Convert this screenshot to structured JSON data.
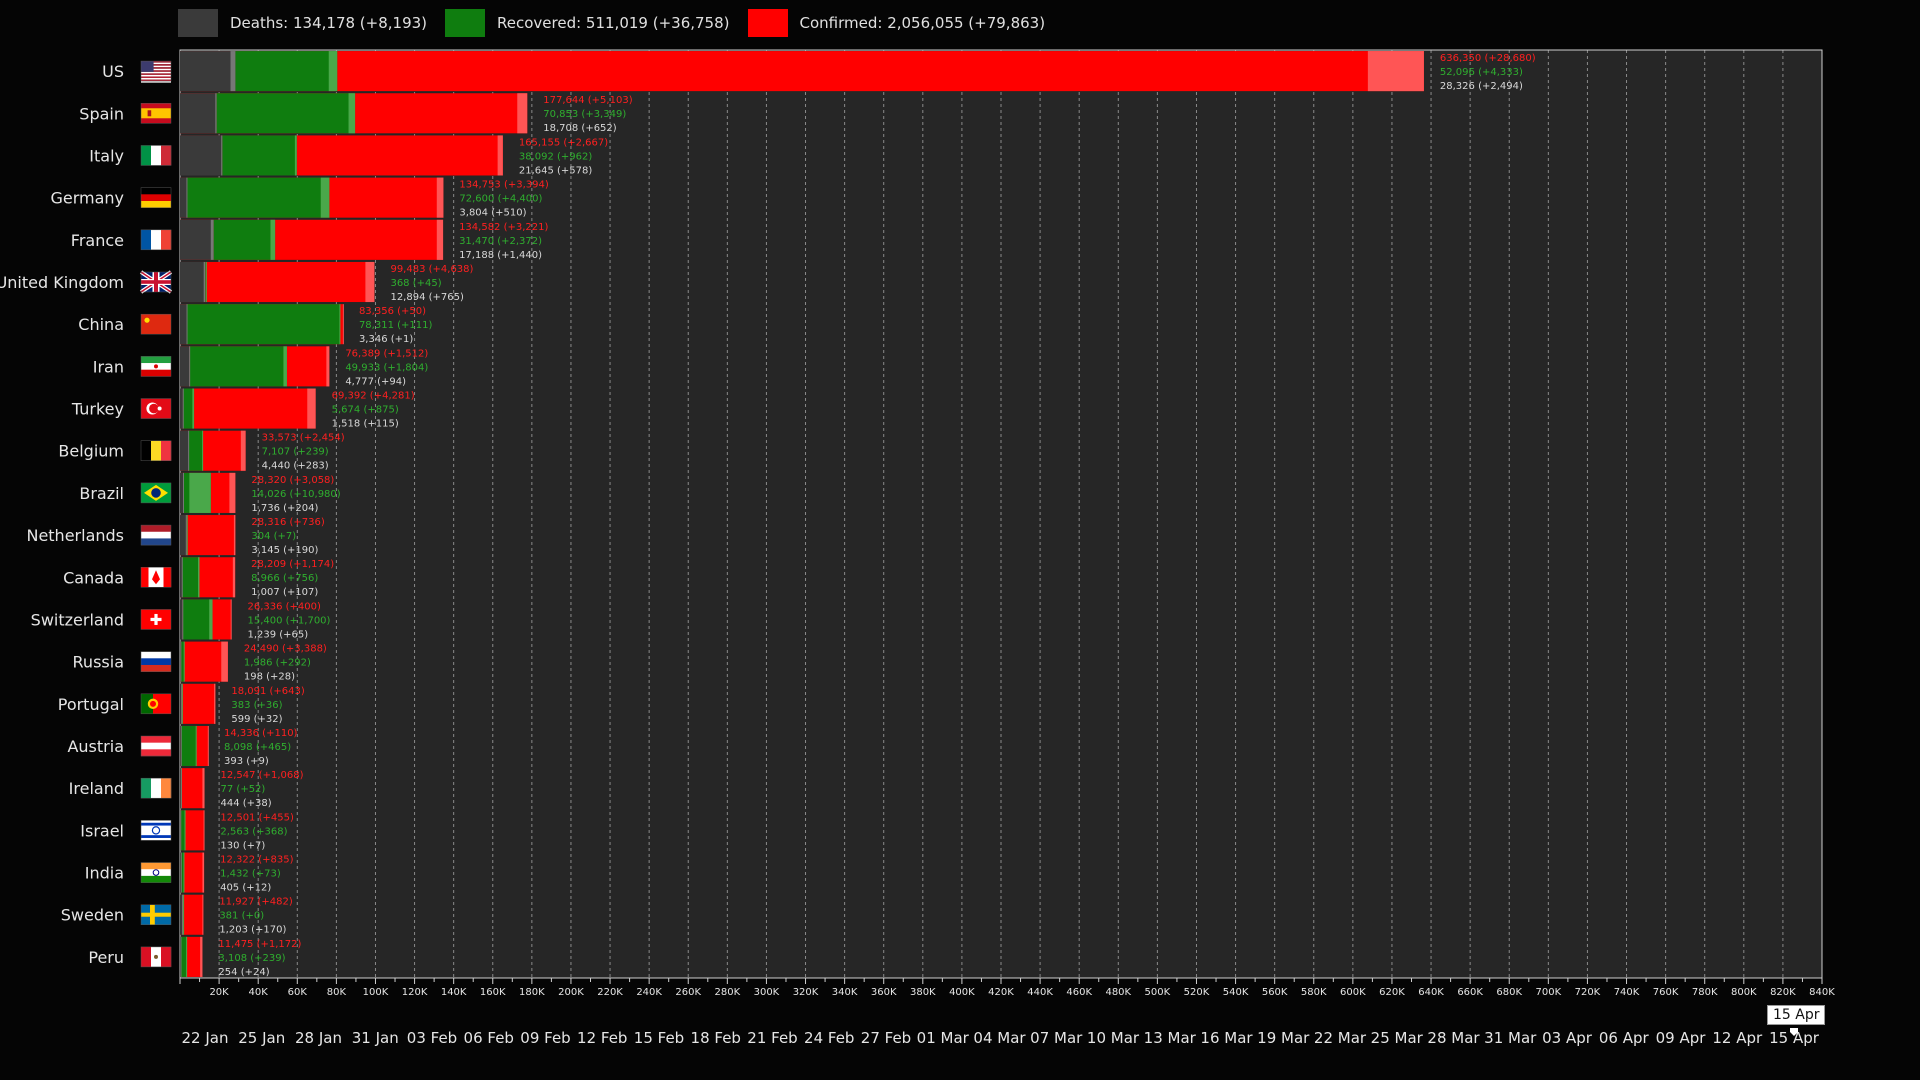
{
  "legend": {
    "deaths": "Deaths: 134,178 (+8,193)",
    "recovered": "Recovered: 511,019 (+36,758)",
    "confirmed": "Confirmed: 2,056,055 (+79,863)"
  },
  "colors": {
    "deaths": "#3a3a3a",
    "recovered": "#0f7d0f",
    "confirmed": "#ff0000",
    "background": "#050505",
    "plot_background": "#262626"
  },
  "current_date": "15 Apr",
  "chart_data": {
    "type": "bar",
    "orientation": "horizontal",
    "stacked": true,
    "xlim": [
      0,
      840000
    ],
    "x_ticks": [
      "20K",
      "40K",
      "60K",
      "80K",
      "100K",
      "120K",
      "140K",
      "160K",
      "180K",
      "200K",
      "220K",
      "240K",
      "260K",
      "280K",
      "300K",
      "320K",
      "340K",
      "360K",
      "380K",
      "400K",
      "420K",
      "440K",
      "460K",
      "480K",
      "500K",
      "520K",
      "540K",
      "560K",
      "580K",
      "600K",
      "620K",
      "640K",
      "660K",
      "680K",
      "700K",
      "720K",
      "740K",
      "760K",
      "780K",
      "800K",
      "820K",
      "840K"
    ],
    "grid": true,
    "legend_position": "top-left",
    "countries": [
      {
        "name": "US",
        "flag": "us",
        "deaths": 28326,
        "recovered": 52096,
        "confirmed": 636350,
        "deaths_label": "28,326 (+2,494)",
        "recovered_label": "52,096 (+4,333)",
        "confirmed_label": "636,350 (+28,680)",
        "new_confirmed": 28680,
        "new_recovered": 4333,
        "new_deaths": 2494
      },
      {
        "name": "Spain",
        "flag": "es",
        "deaths": 18708,
        "recovered": 70853,
        "confirmed": 177644,
        "deaths_label": "18,708 (+652)",
        "recovered_label": "70,853 (+3,349)",
        "confirmed_label": "177,644 (+5,103)",
        "new_confirmed": 5103,
        "new_recovered": 3349,
        "new_deaths": 652
      },
      {
        "name": "Italy",
        "flag": "it",
        "deaths": 21645,
        "recovered": 38092,
        "confirmed": 165155,
        "deaths_label": "21,645 (+578)",
        "recovered_label": "38,092 (+962)",
        "confirmed_label": "165,155 (+2,667)",
        "new_confirmed": 2667,
        "new_recovered": 962,
        "new_deaths": 578
      },
      {
        "name": "Germany",
        "flag": "de",
        "deaths": 3804,
        "recovered": 72600,
        "confirmed": 134753,
        "deaths_label": "3,804 (+510)",
        "recovered_label": "72,600 (+4,400)",
        "confirmed_label": "134,753 (+3,394)",
        "new_confirmed": 3394,
        "new_recovered": 4400,
        "new_deaths": 510
      },
      {
        "name": "France",
        "flag": "fr",
        "deaths": 17188,
        "recovered": 31470,
        "confirmed": 134582,
        "deaths_label": "17,188 (+1,440)",
        "recovered_label": "31,470 (+2,372)",
        "confirmed_label": "134,582 (+3,221)",
        "new_confirmed": 3221,
        "new_recovered": 2372,
        "new_deaths": 1440
      },
      {
        "name": "United Kingdom",
        "flag": "gb",
        "deaths": 12894,
        "recovered": 368,
        "confirmed": 99483,
        "deaths_label": "12,894 (+765)",
        "recovered_label": "368 (+45)",
        "confirmed_label": "99,483 (+4,638)",
        "new_confirmed": 4638,
        "new_recovered": 45,
        "new_deaths": 765
      },
      {
        "name": "China",
        "flag": "cn",
        "deaths": 3346,
        "recovered": 78311,
        "confirmed": 83356,
        "deaths_label": "3,346 (+1)",
        "recovered_label": "78,311 (+111)",
        "confirmed_label": "83,356 (+50)",
        "new_confirmed": 50,
        "new_recovered": 111,
        "new_deaths": 1
      },
      {
        "name": "Iran",
        "flag": "ir",
        "deaths": 4777,
        "recovered": 49933,
        "confirmed": 76389,
        "deaths_label": "4,777 (+94)",
        "recovered_label": "49,933 (+1,804)",
        "confirmed_label": "76,389 (+1,512)",
        "new_confirmed": 1512,
        "new_recovered": 1804,
        "new_deaths": 94
      },
      {
        "name": "Turkey",
        "flag": "tr",
        "deaths": 1518,
        "recovered": 5674,
        "confirmed": 69392,
        "deaths_label": "1,518 (+115)",
        "recovered_label": "5,674 (+875)",
        "confirmed_label": "69,392 (+4,281)",
        "new_confirmed": 4281,
        "new_recovered": 875,
        "new_deaths": 115
      },
      {
        "name": "Belgium",
        "flag": "be",
        "deaths": 4440,
        "recovered": 7107,
        "confirmed": 33573,
        "deaths_label": "4,440 (+283)",
        "recovered_label": "7,107 (+239)",
        "confirmed_label": "33,573 (+2,454)",
        "new_confirmed": 2454,
        "new_recovered": 239,
        "new_deaths": 283
      },
      {
        "name": "Brazil",
        "flag": "br",
        "deaths": 1736,
        "recovered": 14026,
        "confirmed": 28320,
        "deaths_label": "1,736 (+204)",
        "recovered_label": "14,026 (+10,980)",
        "confirmed_label": "28,320 (+3,058)",
        "new_confirmed": 3058,
        "new_recovered": 10980,
        "new_deaths": 204
      },
      {
        "name": "Netherlands",
        "flag": "nl",
        "deaths": 3145,
        "recovered": 304,
        "confirmed": 28316,
        "deaths_label": "3,145 (+190)",
        "recovered_label": "304 (+7)",
        "confirmed_label": "28,316 (+736)",
        "new_confirmed": 736,
        "new_recovered": 7,
        "new_deaths": 190
      },
      {
        "name": "Canada",
        "flag": "ca",
        "deaths": 1007,
        "recovered": 8966,
        "confirmed": 28209,
        "deaths_label": "1,007 (+107)",
        "recovered_label": "8,966 (+756)",
        "confirmed_label": "28,209 (+1,174)",
        "new_confirmed": 1174,
        "new_recovered": 756,
        "new_deaths": 107
      },
      {
        "name": "Switzerland",
        "flag": "ch",
        "deaths": 1239,
        "recovered": 15400,
        "confirmed": 26336,
        "deaths_label": "1,239 (+65)",
        "recovered_label": "15,400 (+1,700)",
        "confirmed_label": "26,336 (+400)",
        "new_confirmed": 400,
        "new_recovered": 1700,
        "new_deaths": 65
      },
      {
        "name": "Russia",
        "flag": "ru",
        "deaths": 198,
        "recovered": 1986,
        "confirmed": 24490,
        "deaths_label": "198 (+28)",
        "recovered_label": "1,986 (+292)",
        "confirmed_label": "24,490 (+3,388)",
        "new_confirmed": 3388,
        "new_recovered": 292,
        "new_deaths": 28
      },
      {
        "name": "Portugal",
        "flag": "pt",
        "deaths": 599,
        "recovered": 383,
        "confirmed": 18091,
        "deaths_label": "599 (+32)",
        "recovered_label": "383 (+36)",
        "confirmed_label": "18,091 (+643)",
        "new_confirmed": 643,
        "new_recovered": 36,
        "new_deaths": 32
      },
      {
        "name": "Austria",
        "flag": "at",
        "deaths": 393,
        "recovered": 8098,
        "confirmed": 14336,
        "deaths_label": "393 (+9)",
        "recovered_label": "8,098 (+465)",
        "confirmed_label": "14,336 (+110)",
        "new_confirmed": 110,
        "new_recovered": 465,
        "new_deaths": 9
      },
      {
        "name": "Ireland",
        "flag": "ie",
        "deaths": 444,
        "recovered": 77,
        "confirmed": 12547,
        "deaths_label": "444 (+38)",
        "recovered_label": "77 (+52)",
        "confirmed_label": "12,547 (+1,068)",
        "new_confirmed": 1068,
        "new_recovered": 52,
        "new_deaths": 38
      },
      {
        "name": "Israel",
        "flag": "il",
        "deaths": 130,
        "recovered": 2563,
        "confirmed": 12501,
        "deaths_label": "130 (+7)",
        "recovered_label": "2,563 (+368)",
        "confirmed_label": "12,501 (+455)",
        "new_confirmed": 455,
        "new_recovered": 368,
        "new_deaths": 7
      },
      {
        "name": "India",
        "flag": "in",
        "deaths": 405,
        "recovered": 1432,
        "confirmed": 12322,
        "deaths_label": "405 (+12)",
        "recovered_label": "1,432 (+73)",
        "confirmed_label": "12,322 (+835)",
        "new_confirmed": 835,
        "new_recovered": 73,
        "new_deaths": 12
      },
      {
        "name": "Sweden",
        "flag": "se",
        "deaths": 1203,
        "recovered": 381,
        "confirmed": 11927,
        "deaths_label": "1,203 (+170)",
        "recovered_label": "381 (+0)",
        "confirmed_label": "11,927 (+482)",
        "new_confirmed": 482,
        "new_recovered": 0,
        "new_deaths": 170
      },
      {
        "name": "Peru",
        "flag": "pe",
        "deaths": 254,
        "recovered": 3108,
        "confirmed": 11475,
        "deaths_label": "254 (+24)",
        "recovered_label": "3,108 (+239)",
        "confirmed_label": "11,475 (+1,172)",
        "new_confirmed": 1172,
        "new_recovered": 239,
        "new_deaths": 24
      }
    ]
  },
  "timeline": {
    "dates": [
      "22 Jan",
      "25 Jan",
      "28 Jan",
      "31 Jan",
      "03 Feb",
      "06 Feb",
      "09 Feb",
      "12 Feb",
      "15 Feb",
      "18 Feb",
      "21 Feb",
      "24 Feb",
      "27 Feb",
      "01 Mar",
      "04 Mar",
      "07 Mar",
      "10 Mar",
      "13 Mar",
      "16 Mar",
      "19 Mar",
      "22 Mar",
      "25 Mar",
      "28 Mar",
      "31 Mar",
      "03 Apr",
      "06 Apr",
      "09 Apr",
      "12 Apr",
      "15 Apr"
    ]
  }
}
